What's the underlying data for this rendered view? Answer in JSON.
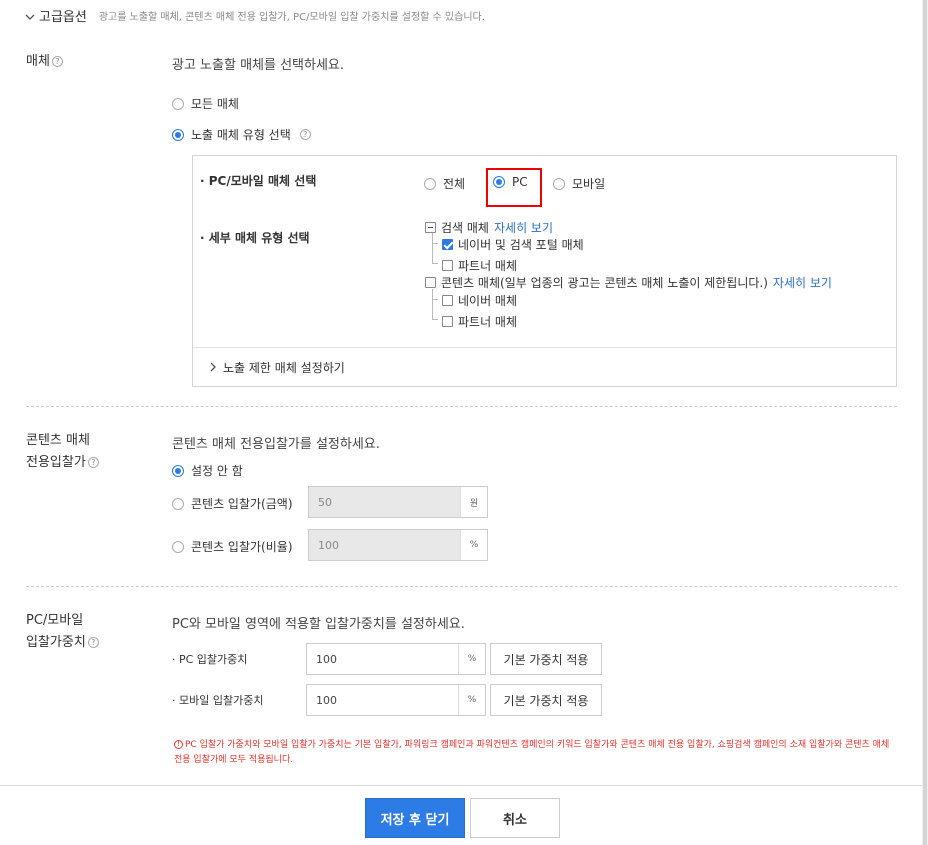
{
  "advanced": {
    "title": "고급옵션",
    "description": "광고를 노출할 매체, 콘텐츠 매체 전용 입찰가, PC/모바일 입찰 가중치를 설정할 수 있습니다."
  },
  "media": {
    "label": "매체",
    "guide": "광고 노출할 매체를 선택하세요.",
    "option_all": "모든 매체",
    "option_type": "노출 매체 유형 선택",
    "selected": "노출 매체 유형 선택",
    "panel": {
      "pc_mobile_label": "· PC/모바일 매체 선택",
      "pc_mobile_options": [
        "전체",
        "PC",
        "모바일"
      ],
      "pc_mobile_selected": "PC",
      "detail_label": "· 세부 매체 유형 선택",
      "search_media": "검색 매체",
      "search_link": "자세히 보기",
      "naver_search_portal": "네이버 및 검색 포털 매체",
      "partner_media_1": "파트너 매체",
      "content_media": "콘텐츠 매체(일부 업종의 광고는 콘텐츠 매체 노출이 제한됩니다.)",
      "content_link": "자세히 보기",
      "naver_media": "네이버 매체",
      "partner_media_2": "파트너 매체",
      "exclusion": "노출 제한 매체 설정하기"
    }
  },
  "content_bid": {
    "label_line1": "콘텐츠 매체",
    "label_line2": "전용입찰가",
    "guide": "콘텐츠 매체 전용입찰가를 설정하세요.",
    "option_none": "설정 안 함",
    "option_amount": "콘텐츠 입찰가(금액)",
    "amount_value": "50",
    "amount_unit": "원",
    "option_ratio": "콘텐츠 입찰가(비율)",
    "ratio_value": "100",
    "ratio_unit": "%",
    "selected": "설정 안 함"
  },
  "weight": {
    "label_line1": "PC/모바일",
    "label_line2": "입찰가중치",
    "guide": "PC와 모바일 영역에 적용할 입찰가중치를 설정하세요.",
    "pc_label": "· PC 입찰가중치",
    "pc_value": "100",
    "pc_unit": "%",
    "pc_button": "기본 가중치 적용",
    "mobile_label": "· 모바일 입찰가중치",
    "mobile_value": "100",
    "mobile_unit": "%",
    "mobile_button": "기본 가중치 적용",
    "warning": "PC 입찰가 가중치와 모바일 입찰가 가중치는 기본 입찰가, 파워링크 캠페인과 파워컨텐츠 캠페인의 키워드 입찰가와 콘텐츠 매체 전용 입찰가, 쇼핑검색 캠페인의 소재 입찰가와 콘텐츠 매체 전용 입찰가에 모두 적용됩니다."
  },
  "footer": {
    "save": "저장 후 닫기",
    "cancel": "취소"
  },
  "colors": {
    "accent": "#2d7be5",
    "warning": "#e0342c",
    "highlight_box": "#ee0000"
  }
}
